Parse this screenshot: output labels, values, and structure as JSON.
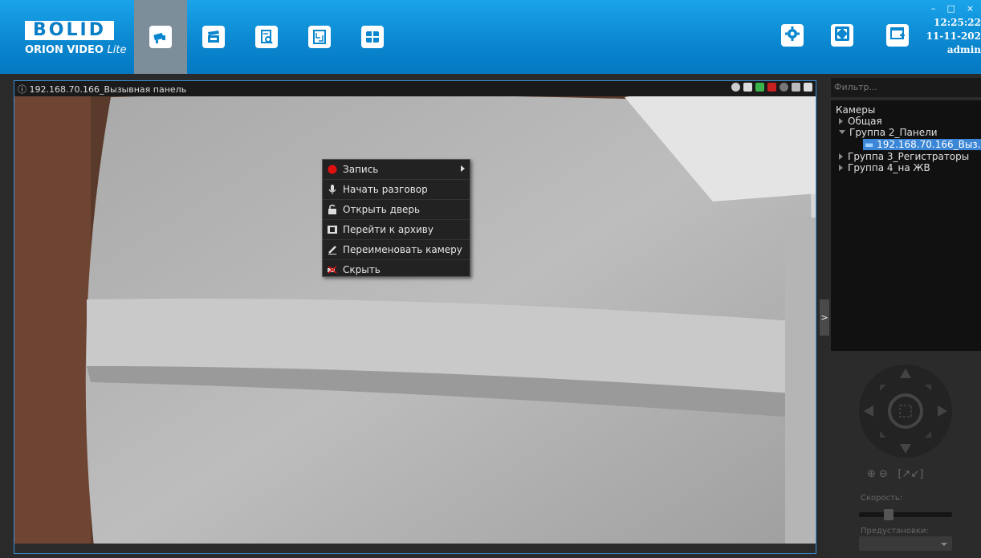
{
  "app": {
    "logo_main": "BOLID",
    "logo_sub": "ORION VIDEO",
    "logo_sub_em": "Lite"
  },
  "toolbar": {
    "tabs": [
      {
        "name": "tab-monitoring",
        "icon": "camera-icon",
        "active": true
      },
      {
        "name": "tab-clips",
        "icon": "clapperboard-icon",
        "active": false
      },
      {
        "name": "tab-archive-search",
        "icon": "document-search-icon",
        "active": false
      },
      {
        "name": "tab-plan",
        "icon": "floor-plan-icon",
        "active": false
      },
      {
        "name": "tab-layout",
        "icon": "grid-layout-icon",
        "active": false
      }
    ],
    "right_buttons": [
      "settings-icon",
      "fullscreen-icon",
      "add-window-icon"
    ]
  },
  "status": {
    "time": "12:25:22",
    "date": "11-11-202",
    "user": "admin"
  },
  "video": {
    "title": "192.168.70.166_Вызывная панель",
    "tool_icons": [
      "zoom-icon",
      "lock-icon",
      "phone-icon",
      "hangup-icon",
      "record-icon",
      "archive-icon",
      "snapshot-icon"
    ]
  },
  "context_menu": {
    "items": [
      {
        "label": "Запись",
        "icon": "record-dot-icon",
        "submenu": true
      },
      {
        "label": "Начать разговор",
        "icon": "microphone-icon",
        "submenu": false
      },
      {
        "label": "Открыть дверь",
        "icon": "unlock-icon",
        "submenu": false
      },
      {
        "label": "Перейти к архиву",
        "icon": "film-icon",
        "submenu": false
      },
      {
        "label": "Переименовать камеру",
        "icon": "pencil-icon",
        "submenu": false
      },
      {
        "label": "Скрыть",
        "icon": "hide-camera-icon",
        "submenu": false
      }
    ]
  },
  "sidebar": {
    "filter_placeholder": "Фильтр...",
    "tree_root": "Камеры",
    "groups": [
      {
        "label": "Общая",
        "expanded": false
      },
      {
        "label": "Группа 2_Панели",
        "expanded": true,
        "children": [
          "192.168.70.166_Выз..."
        ]
      },
      {
        "label": "Группа 3_Регистраторы",
        "expanded": false
      },
      {
        "label": "Группа 4_на ЖВ",
        "expanded": false
      }
    ],
    "toggle_label": ">"
  },
  "ptz": {
    "speed_label": "Скорость:",
    "speed_value": 0.3,
    "presets_label": "Предустановки:",
    "preset_value": ""
  },
  "colors": {
    "accent": "#0a86cf",
    "selection": "#3b86d6",
    "record": "#e01010"
  }
}
